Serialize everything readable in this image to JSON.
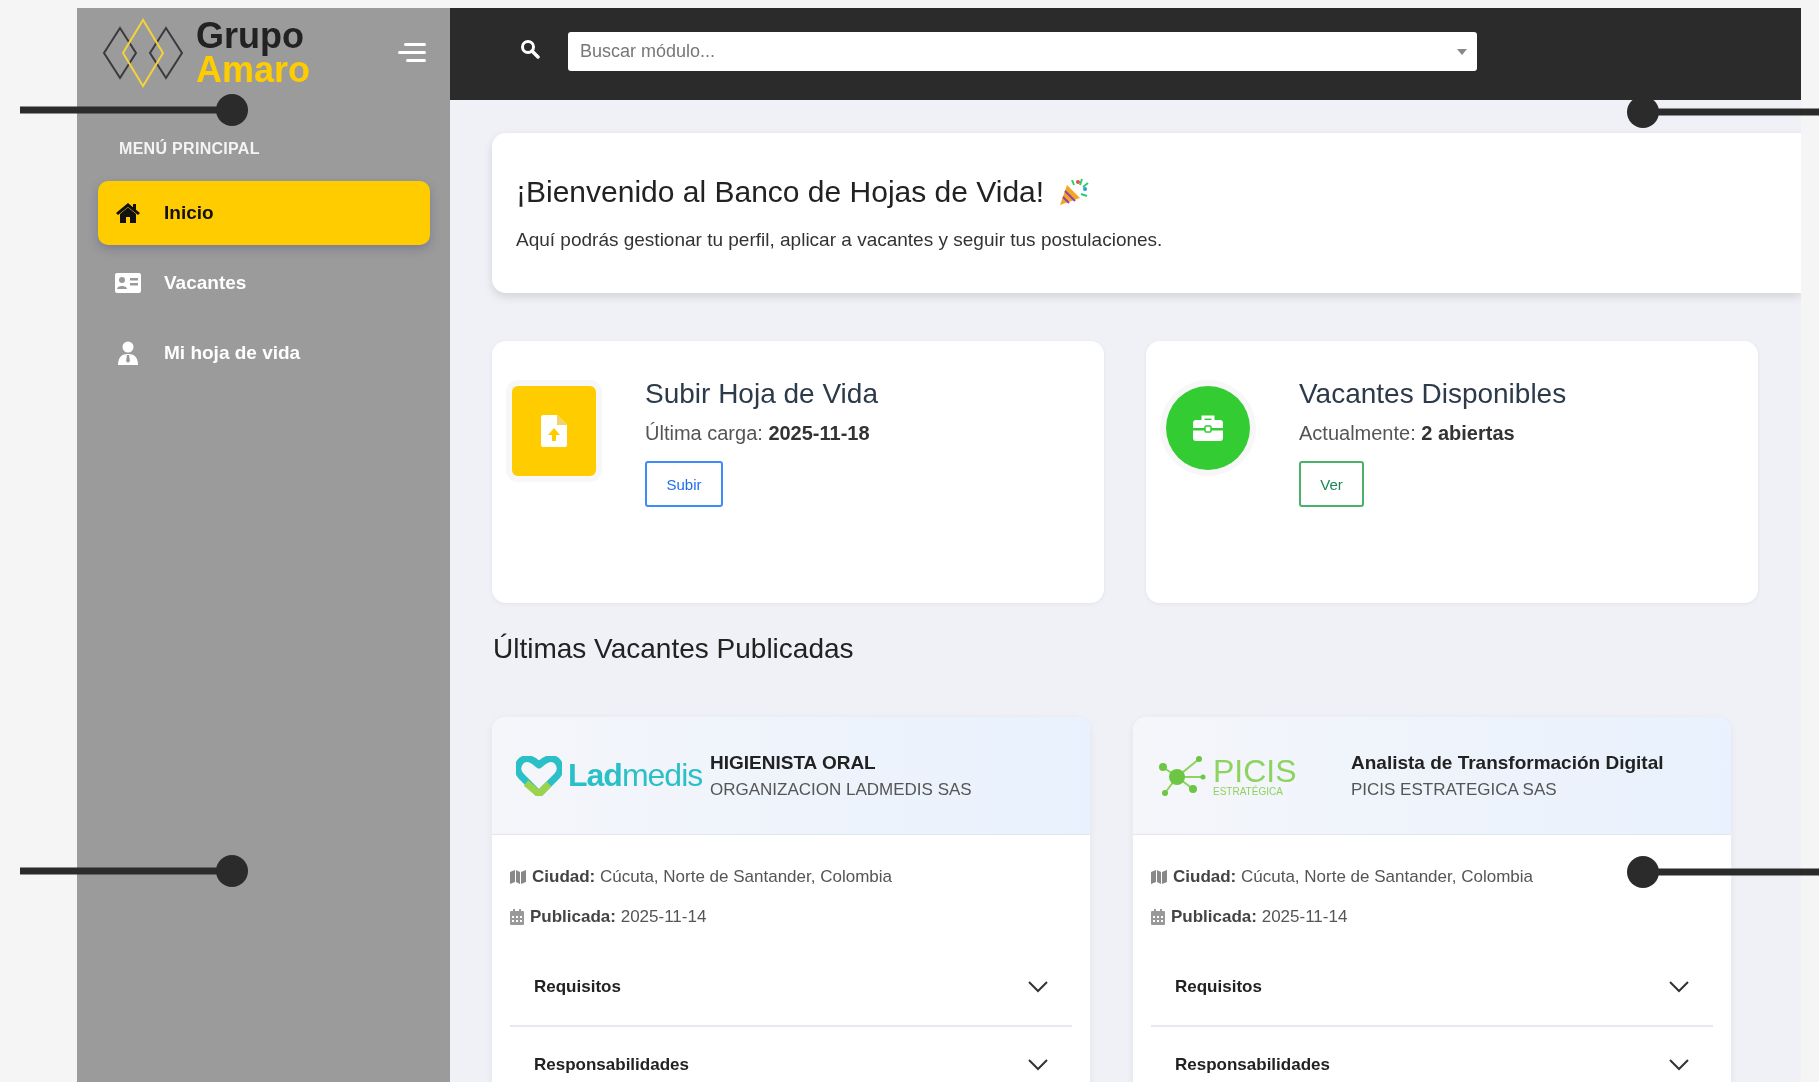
{
  "sidebar": {
    "logo": {
      "line_1": "Grupo",
      "line_2": "Amaro"
    },
    "section_title": "MENÚ PRINCIPAL",
    "items": [
      {
        "label": "Inicio",
        "kind": "home",
        "selected": true
      },
      {
        "label": "Vacantes",
        "kind": "vacancies",
        "selected": false
      },
      {
        "label": "Mi hoja de vida",
        "kind": "profile",
        "selected": false
      }
    ]
  },
  "topbar": {
    "search": {
      "placeholder": "Buscar módulo..."
    }
  },
  "welcome": {
    "title": "¡Bienvenido al Banco de Hojas de Vida!",
    "text": "Aquí podrás gestionar tu perfil, aplicar a vacantes y seguir tus postulaciones."
  },
  "stat_cards": [
    {
      "kind": "upload",
      "title": "Subir Hoja de Vida",
      "label": "Última carga:",
      "value": "2025-11-18",
      "button": "Subir"
    },
    {
      "kind": "vacancies",
      "title": "Vacantes Disponibles",
      "label": "Actualmente:",
      "value": "2 abiertas",
      "button": "Ver"
    }
  ],
  "vacancies_heading": "Últimas Vacantes Publicadas",
  "vacancies": [
    {
      "logo": {
        "kind": "ladmedis",
        "text_1": "Lad",
        "text_2": "medis"
      },
      "title": "HIGIENISTA ORAL",
      "company": "ORGANIZACION LADMEDIS SAS",
      "fields": [
        {
          "kind": "city",
          "label": "Ciudad:",
          "value": "Cúcuta, Norte de Santander, Colombia"
        },
        {
          "kind": "date",
          "label": "Publicada:",
          "value": "2025-11-14"
        }
      ],
      "sections": [
        {
          "label": "Requisitos",
          "expanded": false
        },
        {
          "label": "Responsabilidades",
          "expanded": false
        }
      ]
    },
    {
      "logo": {
        "kind": "picis",
        "text_1": "PICIS",
        "text_2": "ESTRATÉGICA"
      },
      "title": "Analista de Transformación Digital",
      "company": "PICIS ESTRATEGICA SAS",
      "fields": [
        {
          "kind": "city",
          "label": "Ciudad:",
          "value": "Cúcuta, Norte de Santander, Colombia"
        },
        {
          "kind": "date",
          "label": "Publicada:",
          "value": "2025-11-14"
        }
      ],
      "sections": [
        {
          "label": "Requisitos",
          "expanded": false
        },
        {
          "label": "Responsabilidades",
          "expanded": false
        }
      ]
    }
  ]
}
